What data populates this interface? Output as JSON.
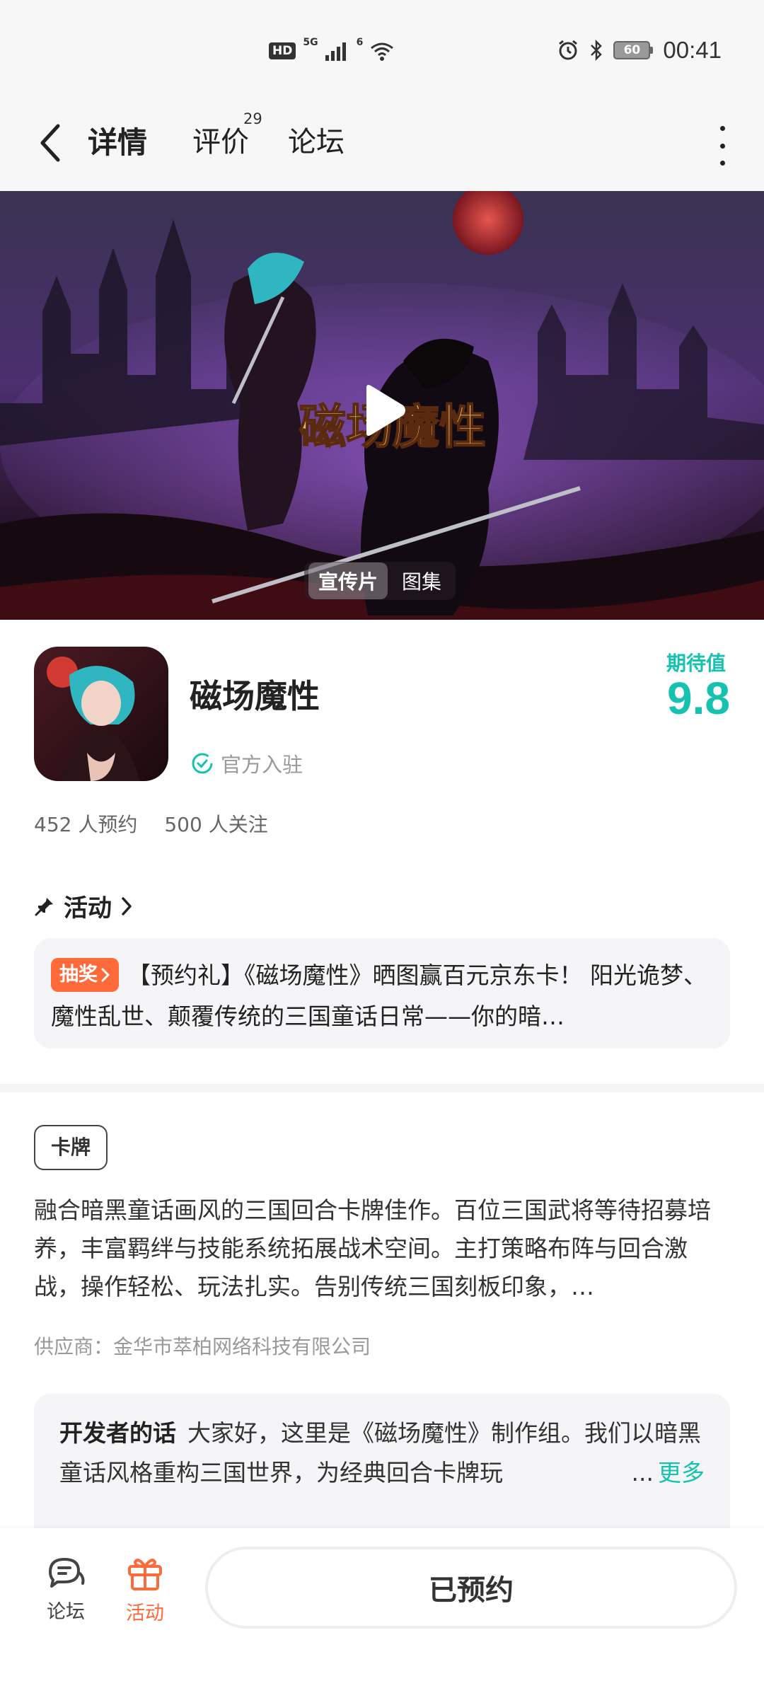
{
  "status_bar": {
    "hd": "HD",
    "signal": "5G",
    "wifi": "6",
    "battery": "60",
    "time": "00:41"
  },
  "nav": {
    "tabs": [
      {
        "label": "详情",
        "active": true
      },
      {
        "label": "评价",
        "count": "29"
      },
      {
        "label": "论坛"
      }
    ]
  },
  "hero": {
    "title_art": "磁场魔性",
    "media_tabs": [
      "宣传片",
      "图集"
    ]
  },
  "app": {
    "name": "磁场魔性",
    "official_label": "官方入驻",
    "expect_label": "期待值",
    "expect_value": "9.8",
    "reservations": "452 人预约",
    "follows": "500 人关注"
  },
  "activity": {
    "section_title": "活动",
    "badge": "抽奖",
    "text": "【预约礼】《磁场魔性》晒图赢百元京东卡！ 阳光诡梦、魔性乱世、颠覆传统的三国童话日常——你的暗…"
  },
  "description": {
    "genre": "卡牌",
    "text": "融合暗黑童话画风的三国回合卡牌佳作。百位三国武将等待招募培养，丰富羁绊与技能系统拓展战术空间。主打策略布阵与回合激战，操作轻松、玩法扎实。告别传统三国刻板印象，…",
    "supplier": "供应商：金华市萃柏网络科技有限公司"
  },
  "developer": {
    "title": "开发者的话",
    "text": "大家好，这里是《磁场魔性》制作组。我们以暗黑童话风格重构三国世界，为经典回合卡牌玩",
    "ellipsis": "...",
    "more": "更多"
  },
  "bottom_bar": {
    "forum": "论坛",
    "activity": "活动",
    "reserve_button": "已预约"
  },
  "colors": {
    "accent": "#15c2b0",
    "orange": "#ff6a3a"
  }
}
